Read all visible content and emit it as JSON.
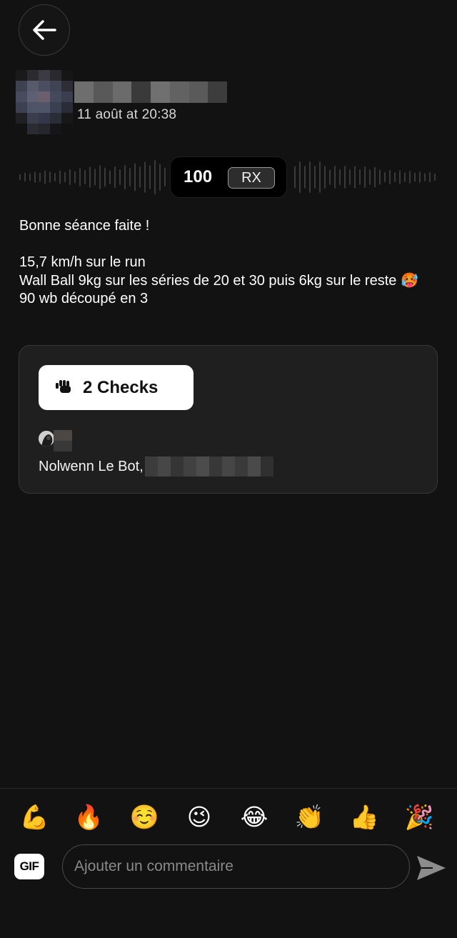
{
  "header": {
    "back_icon": "arrow-left-icon"
  },
  "post": {
    "date": "11 août at 20:38",
    "score": "100",
    "scale_badge": "RX",
    "body_lines": [
      "Bonne séance faite !",
      "",
      "15,7 km/h  sur le run",
      "Wall Ball 9kg sur les séries de 20 et 30 puis 6kg sur le reste 🥵",
      "90 wb découpé en 3"
    ]
  },
  "checks": {
    "button_icon": "fist-bump-icon",
    "button_label": "2 Checks",
    "names_prefix": "Nolwenn Le Bot,"
  },
  "reactions": {
    "emojis": [
      "💪",
      "🔥",
      "☺️",
      "😉",
      "😂",
      "👏",
      "👍",
      "🎉"
    ]
  },
  "composer": {
    "gif_label": "GIF",
    "comment_placeholder": "Ajouter un commentaire",
    "send_icon": "send-icon"
  },
  "colors": {
    "background": "#121212",
    "card": "#1f1f1f",
    "text": "#ffffff",
    "muted_text": "#8a8a8a"
  }
}
